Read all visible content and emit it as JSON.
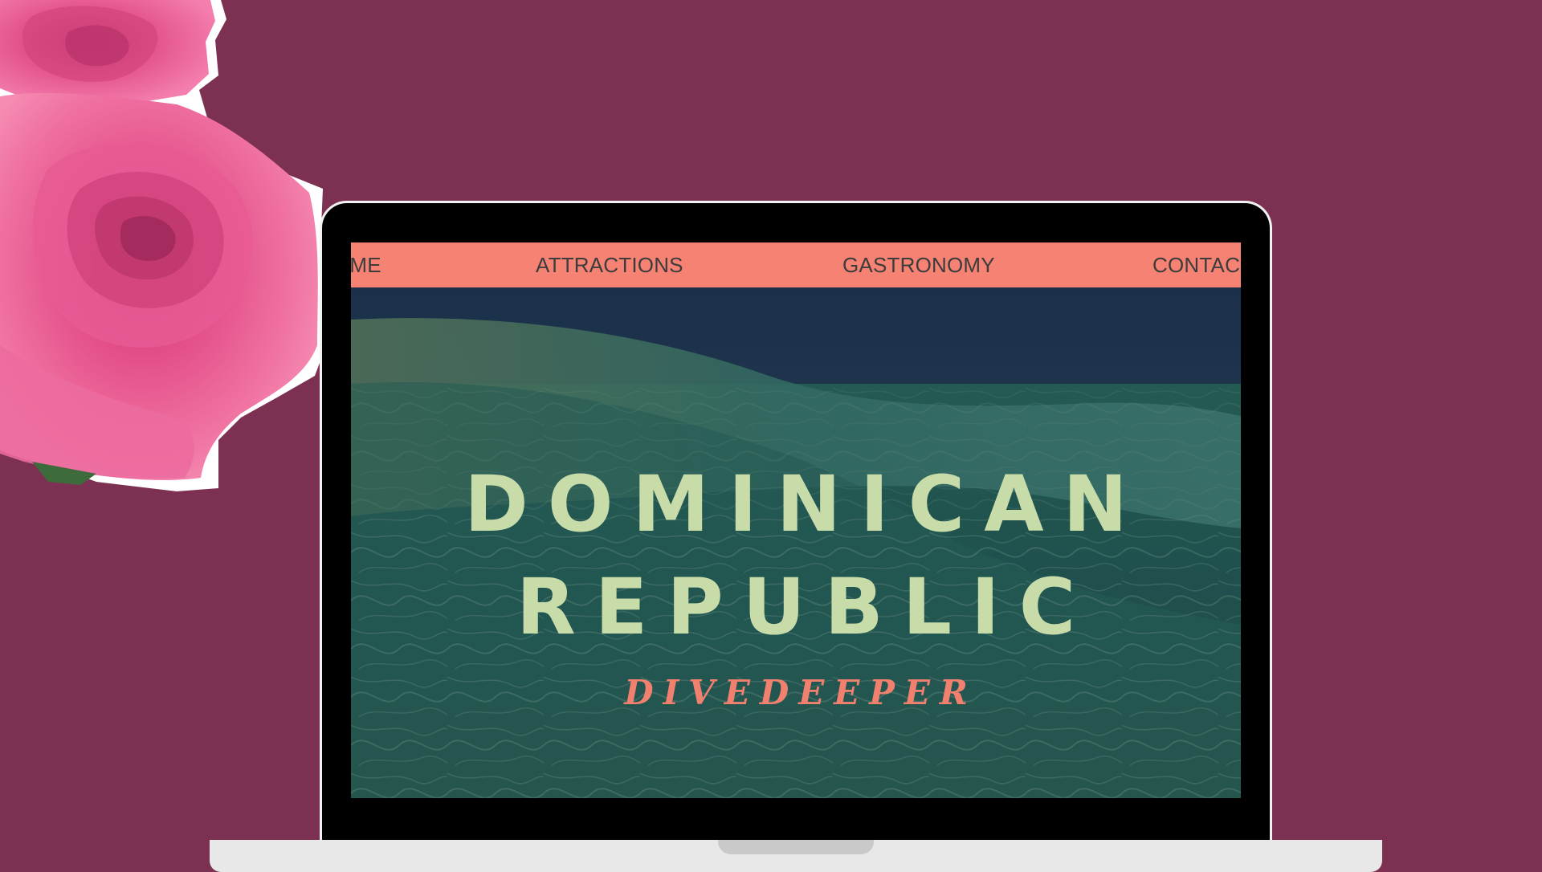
{
  "nav": {
    "items": [
      {
        "label": "OME"
      },
      {
        "label": "ATTRACTIONS"
      },
      {
        "label": "GASTRONOMY"
      },
      {
        "label": "CONTAC"
      }
    ]
  },
  "hero": {
    "title_line1": "DOMINICAN",
    "title_line2": "REPUBLIC",
    "tagline": "DIVEDEEPER"
  },
  "colors": {
    "background": "#7d3152",
    "nav_background": "#f68273",
    "title": "#c8dca9",
    "tagline": "#f2806f"
  },
  "icons": {
    "decoration": "rose-icon"
  }
}
